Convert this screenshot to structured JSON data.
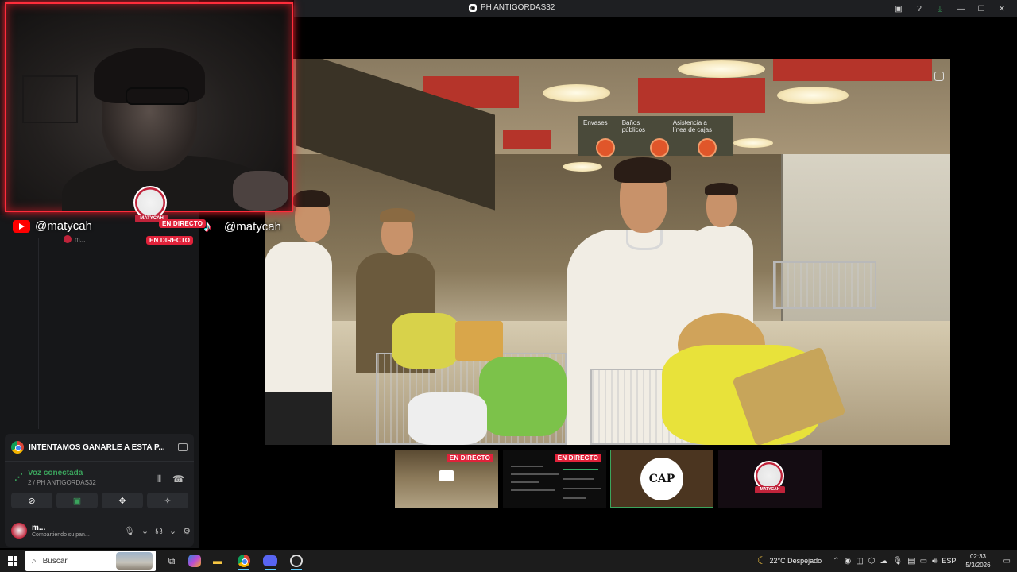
{
  "window": {
    "title": "PH ANTIGORDAS32"
  },
  "overlay": {
    "youtube_handle": "@matycah",
    "tiktok_handle": "@matycah",
    "live_label_1": "EN DIRECTO",
    "live_label_2": "EN DIRECTO",
    "avatar_ribbon": "MATYCAH",
    "small_user": "m..."
  },
  "video": {
    "sign_items": [
      "Envases",
      "Baños públicos",
      "Asistencia a línea de cajas"
    ]
  },
  "thumbnails": [
    {
      "name": "store-stream",
      "live_label": "EN DIRECTO"
    },
    {
      "name": "code-stream",
      "live_label": "EN DIRECTO"
    },
    {
      "name": "cap-avatar",
      "logo_text": "CAP"
    },
    {
      "name": "matycah-avatar",
      "logo_text": "MATYCAH"
    }
  ],
  "voice_panel": {
    "activity_title": "INTENTAMOS GANARLE A ESTA P...",
    "status": "Voz conectada",
    "channel": "2 / PH ANTIGORDAS32",
    "user_name": "m...",
    "user_status": "Compartiendo su pan..."
  },
  "taskbar": {
    "search_placeholder": "Buscar",
    "weather": "22°C  Despejado",
    "language": "ESP",
    "time": "02:33",
    "date": "5/3/2026"
  },
  "colors": {
    "accent_red": "#ff2d3b",
    "discord_green": "#3ba55d",
    "live_red": "#e0223a"
  }
}
